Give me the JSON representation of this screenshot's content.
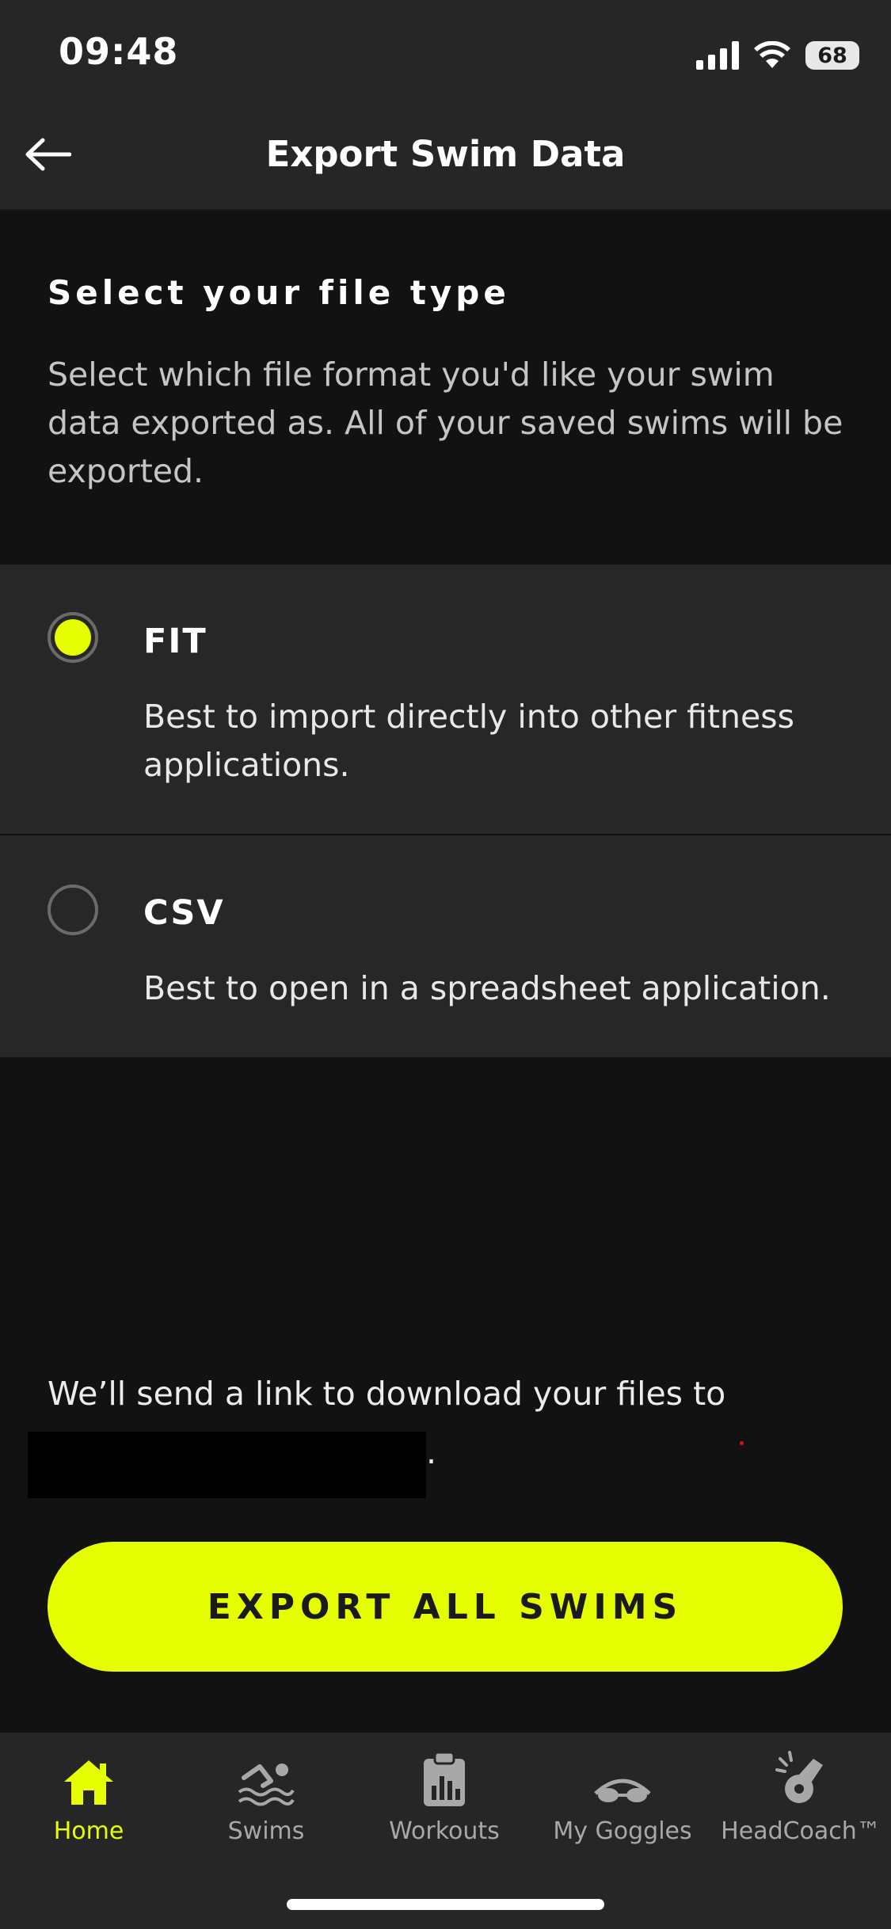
{
  "status_bar": {
    "time": "09:48",
    "battery": "68"
  },
  "header": {
    "title": "Export Swim Data"
  },
  "intro": {
    "heading": "Select your file type",
    "description": "Select which file format you'd like your swim data exported as. All of your saved swims will be exported."
  },
  "options": [
    {
      "label": "FIT",
      "description": "Best to import directly into other fitness applications.",
      "selected": true
    },
    {
      "label": "CSV",
      "description": "Best to open in a spreadsheet application.",
      "selected": false
    }
  ],
  "email_notice": {
    "text": "We’ll send a link to download your files to",
    "period": "."
  },
  "export_button": {
    "label": "EXPORT ALL SWIMS"
  },
  "tabs": [
    {
      "label": "Home",
      "icon": "home-icon",
      "active": true
    },
    {
      "label": "Swims",
      "icon": "swimmer-icon",
      "active": false
    },
    {
      "label": "Workouts",
      "icon": "clipboard-icon",
      "active": false
    },
    {
      "label": "My Goggles",
      "icon": "goggles-icon",
      "active": false
    },
    {
      "label": "HeadCoach™",
      "icon": "whistle-icon",
      "active": false
    }
  ],
  "colors": {
    "accent": "#E5FF00",
    "background": "#121212",
    "surface": "#272727"
  }
}
